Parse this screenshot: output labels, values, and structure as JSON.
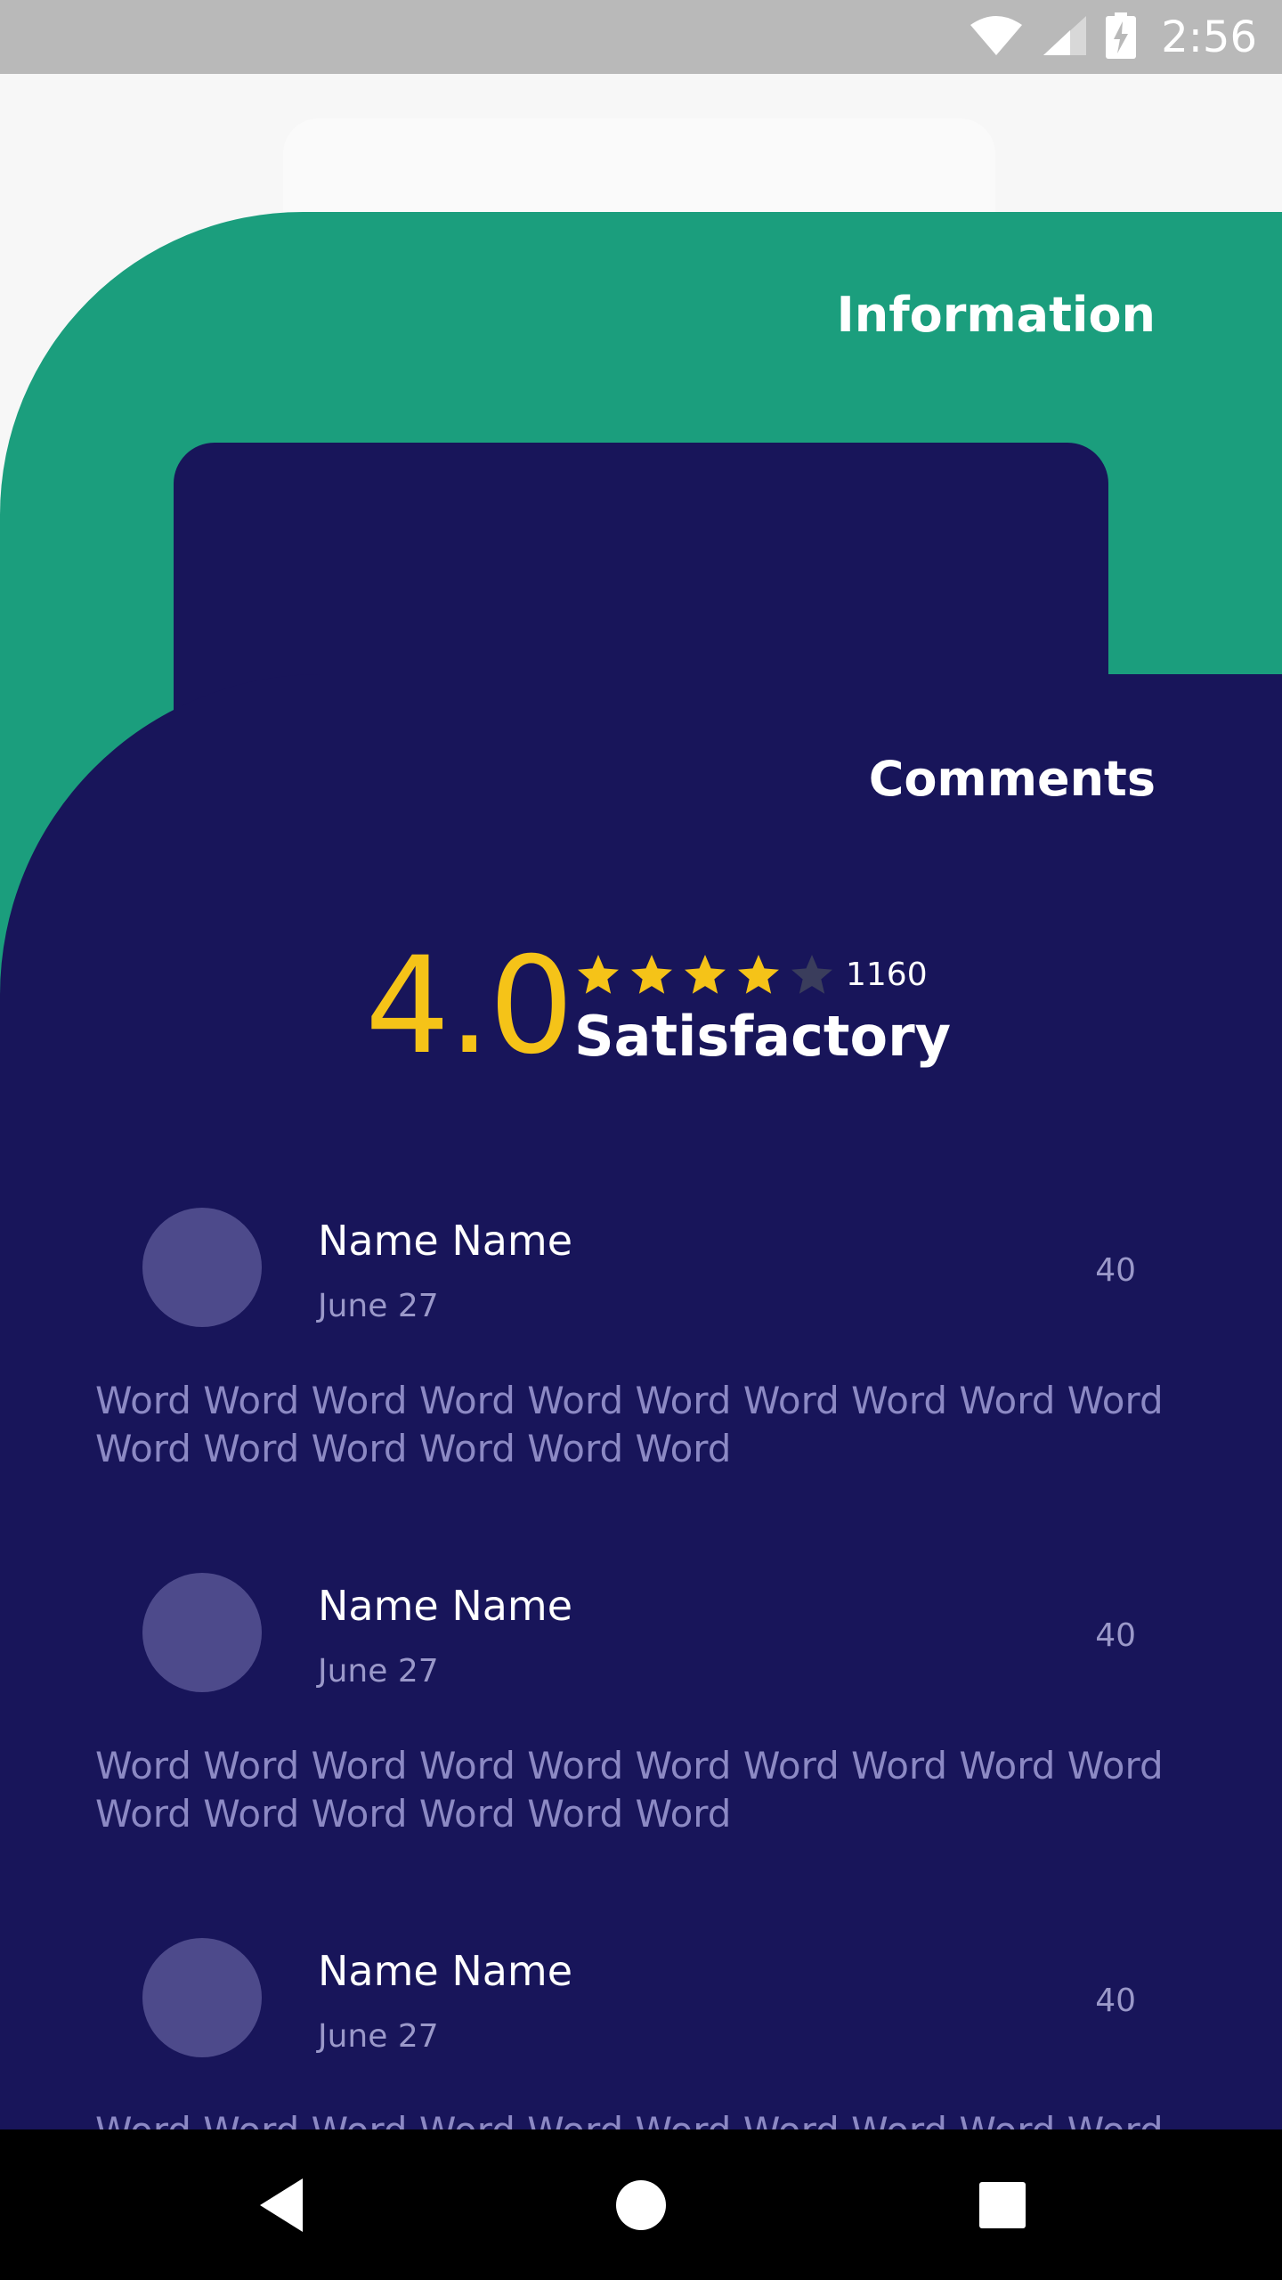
{
  "status_bar": {
    "time": "2:56",
    "icons": [
      "wifi-icon",
      "signal-icon",
      "battery-charging-icon"
    ]
  },
  "sections": {
    "information_title": "Information",
    "comments_title": "Comments"
  },
  "rating": {
    "score": "4.0",
    "stars_filled": 4,
    "stars_total": 5,
    "count": "1160",
    "label": "Satisfactory"
  },
  "comments": [
    {
      "name": "Name Name",
      "date": "June 27",
      "count": "40",
      "text": "Word Word Word Word Word Word Word Word Word Word Word Word Word Word Word Word"
    },
    {
      "name": "Name Name",
      "date": "June 27",
      "count": "40",
      "text": "Word Word Word Word Word Word Word Word Word Word Word Word Word Word Word Word"
    },
    {
      "name": "Name Name",
      "date": "June 27",
      "count": "40",
      "text": "Word Word Word Word Word Word Word Word Word Word Word Word Word Word Word Word"
    }
  ],
  "nav_bar": {
    "buttons": [
      "back-icon",
      "home-icon",
      "recents-icon"
    ]
  },
  "colors": {
    "teal": "#1b9e7d",
    "navy": "#18155a",
    "star": "#f5c318",
    "star_empty": "#3a3d5c",
    "avatar": "#4d4a8b"
  }
}
